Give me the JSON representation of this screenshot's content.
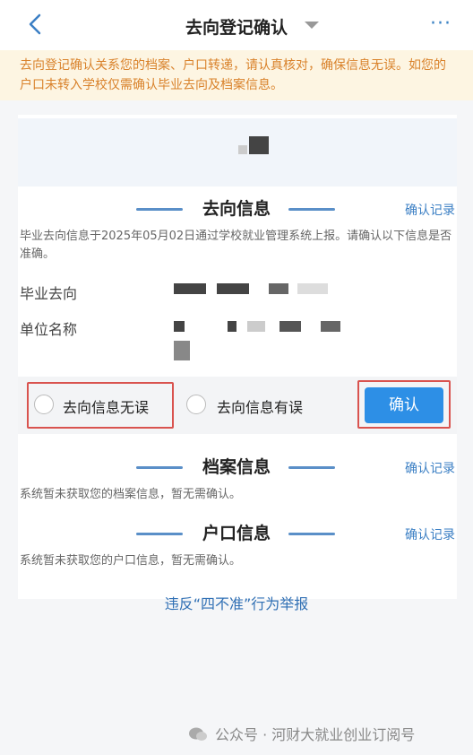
{
  "nav": {
    "title": "去向登记确认",
    "more": "···"
  },
  "notice": "去向登记确认关系您的档案、户口转递，请认真核对，确保信息无误。如您的户口未转入学校仅需确认毕业去向及档案信息。",
  "destination": {
    "heading": "去向信息",
    "record_link": "确认记录",
    "desc": "毕业去向信息于2025年05月02日通过学校就业管理系统上报。请确认以下信息是否准确。",
    "fields": [
      {
        "label": "毕业去向"
      },
      {
        "label": "单位名称"
      }
    ],
    "options": [
      {
        "label": "去向信息无误"
      },
      {
        "label": "去向信息有误"
      }
    ],
    "confirm_label": "确认"
  },
  "archive": {
    "heading": "档案信息",
    "record_link": "确认记录",
    "desc": "系统暂未获取您的档案信息，暂无需确认。"
  },
  "hukou": {
    "heading": "户口信息",
    "record_link": "确认记录",
    "desc": "系统暂未获取您的户口信息，暂无需确认。"
  },
  "report_link": "违反“四不准”行为举报",
  "footer": "公众号 · 河财大就业创业订阅号",
  "colors": {
    "accent": "#2d8fe6",
    "link": "#3b7fc4",
    "notice_text": "#d9822b",
    "notice_bg": "#fdf5e2",
    "highlight_border": "#d9534f"
  }
}
